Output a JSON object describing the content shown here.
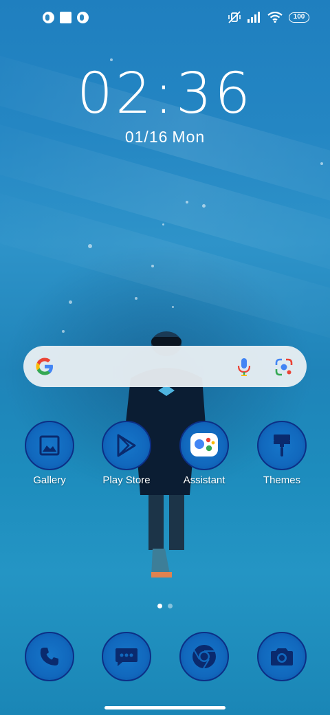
{
  "status_bar": {
    "left_icons": [
      "notification-icon",
      "square-notification-icon",
      "notification-icon"
    ],
    "right_icons": [
      "mute-vibrate-icon",
      "signal-icon",
      "wifi-icon"
    ],
    "battery": "100"
  },
  "clock": {
    "time": "02:36",
    "date": "01/16",
    "weekday": "Mon"
  },
  "search_bar": {
    "icons": [
      "google-g-icon",
      "microphone-icon",
      "google-lens-icon"
    ]
  },
  "apps": [
    {
      "label": "Gallery",
      "icon": "gallery-icon"
    },
    {
      "label": "Play Store",
      "icon": "play-store-icon"
    },
    {
      "label": "Assistant",
      "icon": "assistant-icon"
    },
    {
      "label": "Themes",
      "icon": "themes-brush-icon"
    }
  ],
  "page_indicator": {
    "pages": 2,
    "current": 1
  },
  "dock": [
    {
      "icon": "phone-icon"
    },
    {
      "icon": "messages-icon"
    },
    {
      "icon": "chrome-icon"
    },
    {
      "icon": "camera-icon"
    }
  ],
  "colors": {
    "icon_fill": "#1168bd",
    "icon_border": "#0c2f86",
    "water": "#2486c3"
  }
}
